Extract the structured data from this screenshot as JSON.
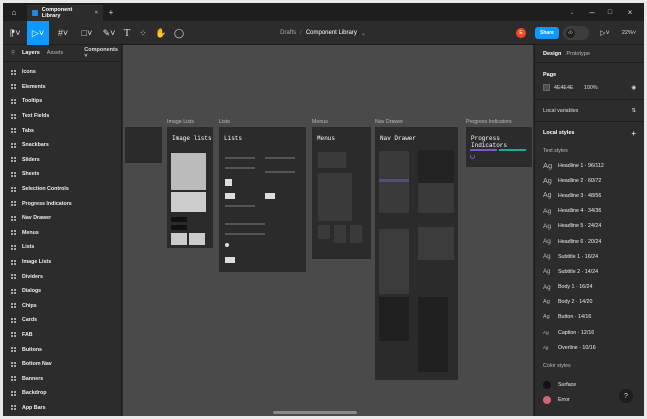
{
  "titlebar": {
    "tab_title": "Component Library",
    "new_tab": "+"
  },
  "toolbar": {
    "breadcrumb_parent": "Drafts",
    "breadcrumb_sep": "/",
    "file_name": "Component Library",
    "avatar_initial": "E",
    "share_label": "Share",
    "zoom": "22%"
  },
  "sidebar": {
    "tabs": [
      "Layers",
      "Assets"
    ],
    "components_label": "Components",
    "layers": [
      "Icons",
      "Elements",
      "Tooltips",
      "Text Fields",
      "Tabs",
      "Snackbars",
      "Sliders",
      "Sheets",
      "Selection Controls",
      "Progress Indicators",
      "Nav Drawer",
      "Menus",
      "Lists",
      "Image Lists",
      "Dividers",
      "Dialogs",
      "Chips",
      "Cards",
      "FAB",
      "Buttons",
      "Bottom Nav",
      "Banners",
      "Backdrop",
      "App Bars"
    ]
  },
  "canvas": {
    "frames": [
      {
        "label": "Image Lists",
        "title": "Image lists"
      },
      {
        "label": "Lists",
        "title": "Lists"
      },
      {
        "label": "Menus",
        "title": "Menus"
      },
      {
        "label": "Nav Drawer",
        "title": "Nav Drawer"
      },
      {
        "label": "Progress Indicators",
        "title": "Progress Indicators"
      }
    ]
  },
  "right": {
    "tabs": [
      "Design",
      "Prototype"
    ],
    "page_label": "Page",
    "page_color": "4E4E4E",
    "page_opacity": "100%",
    "local_variables": "Local variables",
    "local_styles": "Local styles",
    "text_styles_label": "Text styles",
    "text_styles": [
      "Headline 1 · 96/112",
      "Headline 2 · 60/72",
      "Headline 3 · 48/56",
      "Headline 4 · 34/36",
      "Headline 5 · 24/24",
      "Headline 6 · 20/24",
      "Subtitle 1 · 16/24",
      "Subtitle 2 · 14/24",
      "Body 1 · 16/24",
      "Body 2 · 14/20",
      "Button · 14/16",
      "Caption · 12/16",
      "Overline · 10/16"
    ],
    "ag": "Ag",
    "color_styles_label": "Color styles",
    "color_styles": [
      {
        "name": "Surface",
        "color": "#111111"
      },
      {
        "name": "Error",
        "color": "#cf6679"
      }
    ],
    "help": "?"
  },
  "colors": {
    "accent": "#0d99ff",
    "avatar": "#f24822"
  }
}
